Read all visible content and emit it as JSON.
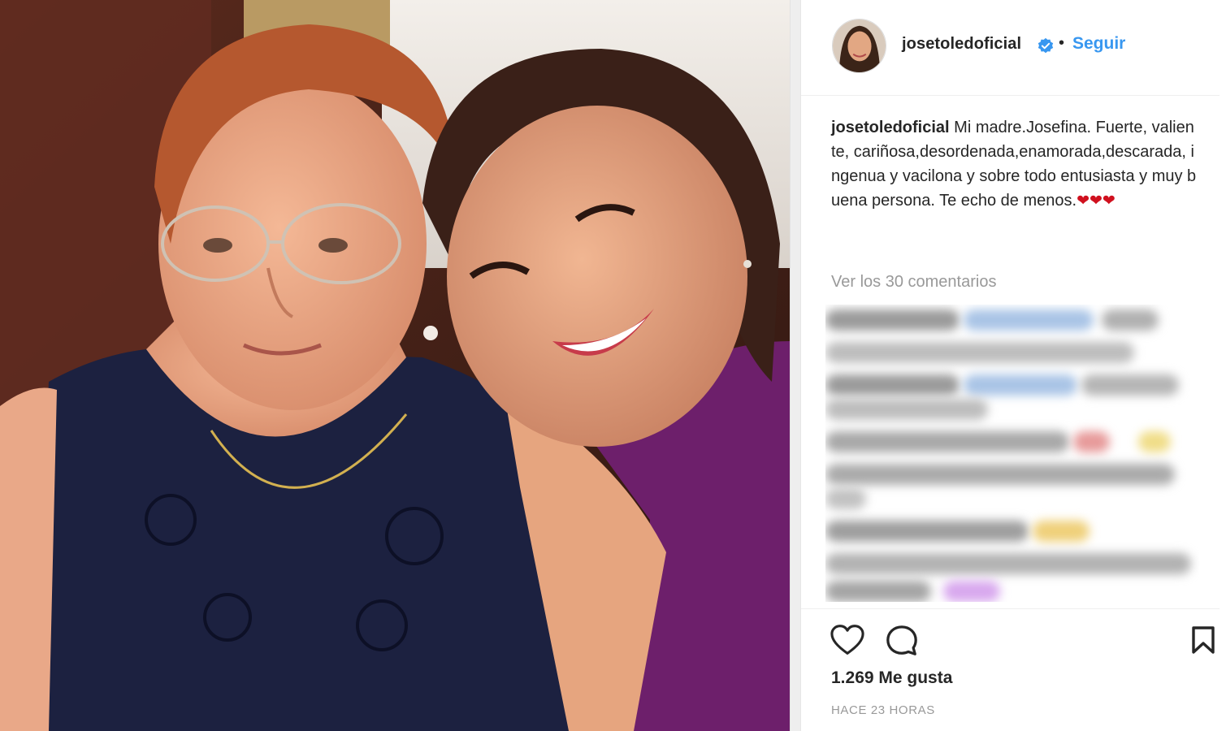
{
  "post": {
    "username": "josetoledoficial",
    "separator": "•",
    "follow_label": "Seguir",
    "caption_user": "josetoledoficial",
    "caption_text": "Mi madre.Josefina. Fuerte, valiente, cariñosa,desordenada,enamorada,descarada, ingenua y vacilona y sobre todo entusiasta y muy buena persona. Te echo de menos.",
    "caption_emoji": "❤❤❤",
    "view_comments": "Ver los 30 comentarios",
    "likes": "1.269 Me gusta",
    "time_ago": "HACE 23 HORAS"
  },
  "icons": {
    "verified": "verified-badge-icon",
    "like": "heart-icon",
    "comment": "comment-bubble-icon",
    "save": "bookmark-icon"
  },
  "colors": {
    "link": "#3897f0",
    "heart": "#d0101e",
    "muted": "#999999",
    "text": "#262626"
  }
}
